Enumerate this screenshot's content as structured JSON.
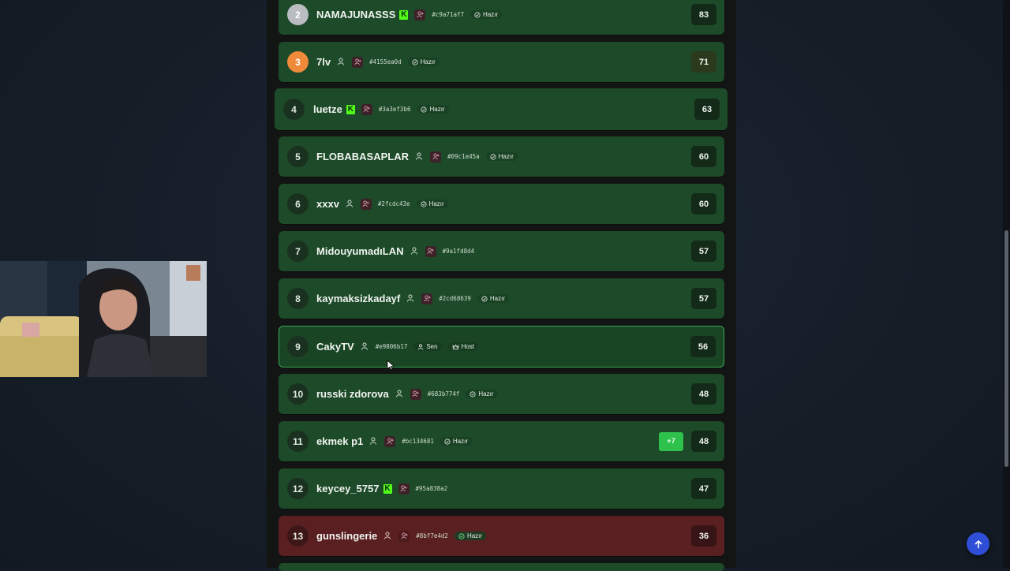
{
  "leaderboard": {
    "rows": [
      {
        "rank": "2",
        "name": "NAMAJUNASSS",
        "kick": true,
        "code": "#c9a71af7",
        "status": "Hazır",
        "score": "83"
      },
      {
        "rank": "3",
        "name": "7lv",
        "kick": false,
        "code": "#4155ea0d",
        "status": "Hazır",
        "score": "71"
      },
      {
        "rank": "4",
        "name": "luetze",
        "kick": true,
        "code": "#3a3ef3b6",
        "status": "Hazır",
        "score": "63"
      },
      {
        "rank": "5",
        "name": "FLOBABASAPLAR",
        "kick": false,
        "code": "#09c1e45a",
        "status": "Hazır",
        "score": "60"
      },
      {
        "rank": "6",
        "name": "xxxv",
        "kick": false,
        "code": "#2fcdc43e",
        "status": "Hazır",
        "score": "60"
      },
      {
        "rank": "7",
        "name": "MidouyumadıLAN",
        "kick": false,
        "code": "#9a1fd8d4",
        "status": "",
        "score": "57"
      },
      {
        "rank": "8",
        "name": "kaymaksizkadayf",
        "kick": false,
        "code": "#2cd68639",
        "status": "Hazır",
        "score": "57"
      },
      {
        "rank": "9",
        "name": "CakyTV",
        "kick": false,
        "code": "#e9806b17",
        "you": "Sen",
        "host": "Host",
        "score": "56"
      },
      {
        "rank": "10",
        "name": "russki zdorova",
        "kick": false,
        "code": "#683b774f",
        "status": "Hazır",
        "score": "48"
      },
      {
        "rank": "11",
        "name": "ekmek p1",
        "kick": false,
        "code": "#bc134681",
        "status": "Hazır",
        "score": "48",
        "delta": "+7"
      },
      {
        "rank": "12",
        "name": "keycey_5757",
        "kick": true,
        "code": "#95a838a2",
        "status": "",
        "score": "47"
      },
      {
        "rank": "13",
        "name": "gunslingerie",
        "kick": false,
        "code": "#8bf7e4d2",
        "status": "Hazır",
        "score": "36"
      }
    ]
  },
  "colors": {
    "row_green": "#1d4a28",
    "row_red": "#5a1f20",
    "self_border": "#3aa957",
    "silver_rank": "#b9bdc2",
    "bronze_rank": "#ee8a3a",
    "kick_green": "#53fc18",
    "delta_green": "#2ec24d",
    "scroll_top_button": "#2f4ed7"
  },
  "icons": {
    "user": "user-icon",
    "add_friend": "add-friend-icon",
    "ready": "check-circle-icon",
    "host": "crown-icon",
    "scroll_top": "arrow-up-icon",
    "kick": "kick-logo-icon"
  }
}
